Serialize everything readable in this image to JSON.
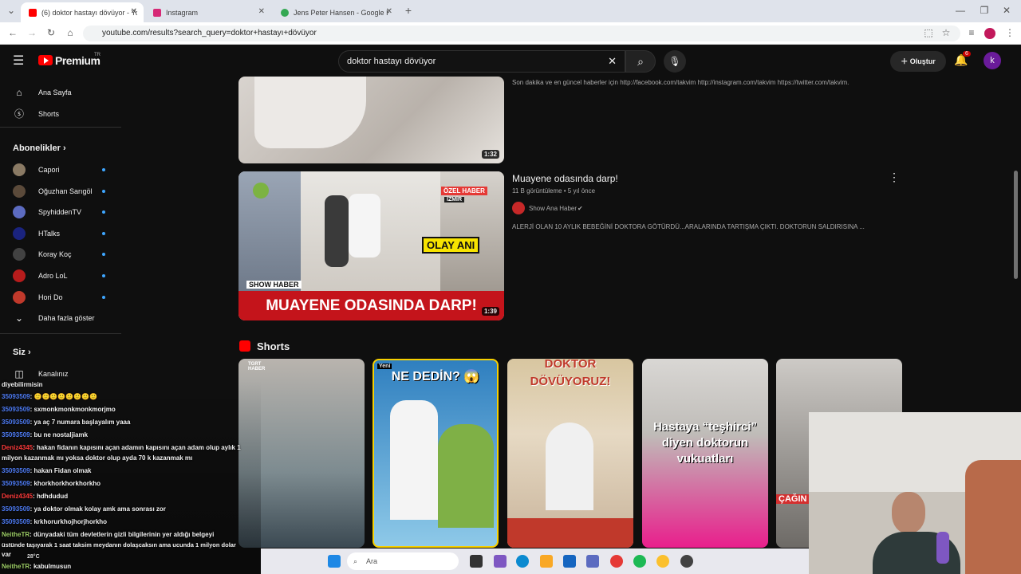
{
  "browser": {
    "tabs": [
      {
        "title": "(6) doktor hastayı dövüyor - Yo",
        "color": "#ff0000"
      },
      {
        "title": "Instagram",
        "color": "#d62976"
      },
      {
        "title": "Jens Peter Hansen - Google Ha",
        "color": "#34a853"
      }
    ],
    "new_tab_label": "+",
    "url": "youtube.com/results?search_query=doktor+hastayı+dövüyor"
  },
  "header": {
    "logo_text": "Premium",
    "logo_region": "TR",
    "search_value": "doktor hastayı dövüyor",
    "create_label": "Oluştur",
    "notification_count": "6",
    "avatar_letter": "k"
  },
  "sidebar": {
    "home": "Ana Sayfa",
    "shorts": "Shorts",
    "subscriptions_title": "Abonelikler",
    "channels": [
      {
        "name": "Capori",
        "color": "#8a7a64"
      },
      {
        "name": "Oğuzhan Sarıgöl",
        "color": "#5b4a3a"
      },
      {
        "name": "SpyhiddenTV",
        "color": "#5c6bc0"
      },
      {
        "name": "HTalks",
        "color": "#1a237e"
      },
      {
        "name": "Koray Koç",
        "color": "#424242"
      },
      {
        "name": "Adro LoL",
        "color": "#b71c1c"
      },
      {
        "name": "Hori Do",
        "color": "#c0392b"
      }
    ],
    "show_more": "Daha fazla göster",
    "you_title": "Siz",
    "your_channel": "Kanalınız"
  },
  "results": [
    {
      "description": "Son dakika ve en güncel haberler için http://facebook.com/takvim http://instagram.com/takvim https://twitter.com/takvim.",
      "duration": "1:32"
    },
    {
      "title": "Muayene odasında darp!",
      "meta": "11 B görüntüleme • 5 yıl önce",
      "channel": "Show Ana Haber",
      "description": "ALERJİ OLAN 10 AYLIK BEBEĞİNİ DOKTORA GÖTÜRDÜ...ARALARINDA TARTIŞMA ÇIKTI. DOKTORUN SALDIRISINA ...",
      "duration": "1:39",
      "thumb_banner": "MUAYENE ODASINDA DARP!",
      "thumb_tag1": "ÖZEL HABER",
      "thumb_tag2": "İZMİR",
      "thumb_olay": "OLAY ANI",
      "thumb_show": "SHOW HABER"
    }
  ],
  "shorts_section": {
    "title": "Shorts",
    "items": [
      {
        "overlay": "TGRT HABER",
        "bg": "#8d8a86"
      },
      {
        "overlay": "NE DEDİN? 😱",
        "badge": "Yeni",
        "bg": "#2f7fbf"
      },
      {
        "overlay": "DOKTOR DÖVÜYORUZ!",
        "bg": "#d8c6a0"
      },
      {
        "overlay": "Hastaya “teşhirci” diyen doktorun vukuatları",
        "bg": "#e91e8c"
      },
      {
        "overlay": "ÇAĞIN",
        "bg": "#6d6a66"
      }
    ]
  },
  "chat": {
    "lines": [
      {
        "user": "",
        "text": "diyebilirmisin"
      },
      {
        "user": "35093509",
        "text": ": 🙂🙂🙂🙂🙂🙂🙂🙂"
      },
      {
        "user": "35093509",
        "text": ": sxmonkmonkmonkmorjmo"
      },
      {
        "user": "35093509",
        "text": ": ya aç 7 numara başlayalım yaaa"
      },
      {
        "user": "35093509",
        "text": ": bu ne nostaljiamk"
      },
      {
        "user": "Deniz4345",
        "text": ": hakan fidanın kapısını açan adamın kapısını açan adam olup aylık 1",
        "red": true
      },
      {
        "user": "",
        "text": "milyon kazanmak mı yoksa doktor olup ayda 70 k kazanmak mı"
      },
      {
        "user": "35093509",
        "text": ": hakan Fidan olmak"
      },
      {
        "user": "35093509",
        "text": ": khorkhorkhorkhorkho"
      },
      {
        "user": "Deniz4345",
        "text": ": hdhdudud",
        "red": true
      },
      {
        "user": "35093509",
        "text": ": ya doktor olmak kolay amk ama sonrası zor"
      },
      {
        "user": "35093509",
        "text": ": krkhorurkhojhorjhorkho"
      },
      {
        "user": "NeitheTR",
        "text": ": dünyadaki tüm devletlerin gizli bilgilerinin yer aldığı belgeyi"
      },
      {
        "user": "",
        "text": "üstünde taşıyarak 1 saat taksim meydanın dolaşcaksın ama ucunda 1 milyon dolar"
      },
      {
        "user": "",
        "text": "var"
      },
      {
        "user": "NeitheTR",
        "text": ": kabulmusun"
      }
    ],
    "weather": "28°C"
  },
  "taskbar": {
    "search_placeholder": "Ara"
  },
  "colors": {
    "accent": "#ff0000",
    "link": "#3ea6ff"
  }
}
